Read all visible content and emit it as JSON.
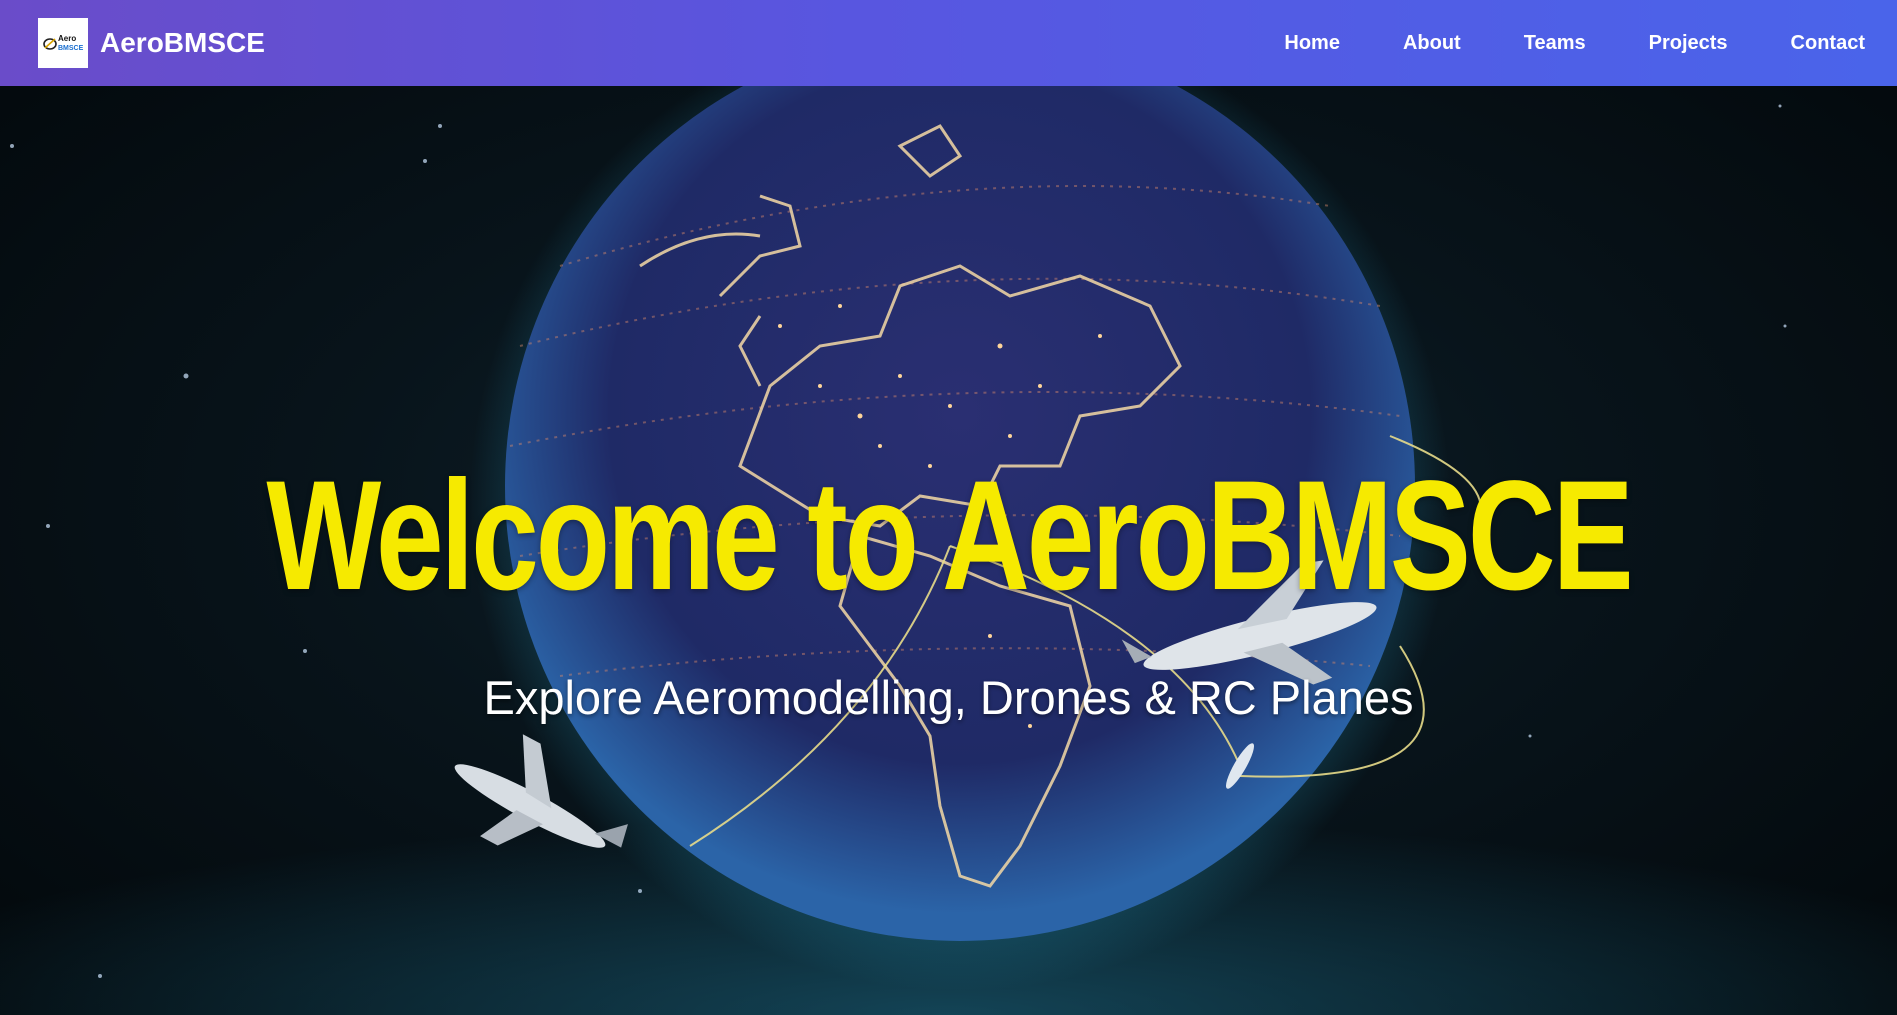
{
  "navbar": {
    "logo_alt": "AeroBMSCE logo",
    "logo_text_top": "Aero",
    "logo_text_bottom": "BMSCE",
    "brand": "AeroBMSCE",
    "links": [
      "Home",
      "About",
      "Teams",
      "Projects",
      "Contact"
    ],
    "gradient_start": "#6a4cc9",
    "gradient_end": "#4a64ea"
  },
  "hero": {
    "title": "Welcome to AeroBMSCE",
    "subtitle": "Explore Aeromodelling, Drones & RC Planes",
    "title_color": "#f6ea00",
    "background_image": "globe-with-airplanes"
  }
}
